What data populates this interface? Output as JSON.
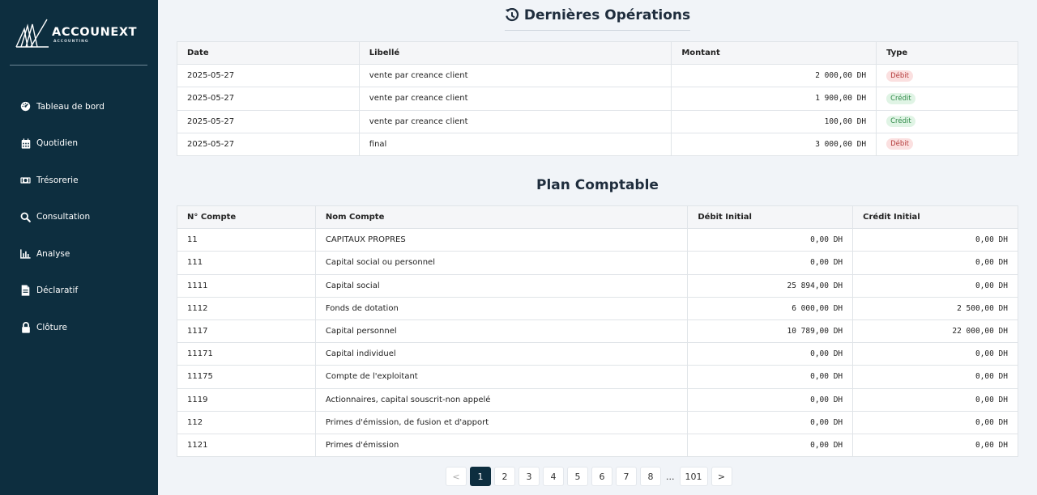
{
  "brand": {
    "name": "ACCOUNEXT",
    "subtitle": "ACCOUNTING"
  },
  "sidebar": {
    "items": [
      {
        "label": "Tableau de bord",
        "icon": "gauge-icon"
      },
      {
        "label": "Quotidien",
        "icon": "calendar-icon"
      },
      {
        "label": "Trésorerie",
        "icon": "money-bill-icon"
      },
      {
        "label": "Consultation",
        "icon": "search-icon"
      },
      {
        "label": "Analyse",
        "icon": "bar-chart-icon"
      },
      {
        "label": "Déclaratif",
        "icon": "file-icon"
      },
      {
        "label": "Clôture",
        "icon": "lock-icon"
      }
    ]
  },
  "operations": {
    "title": "Dernières Opérations",
    "headers": [
      "Date",
      "Libellé",
      "Montant",
      "Type"
    ],
    "rows": [
      {
        "date": "2025-05-27",
        "libelle": "vente par creance client",
        "montant": "2 000,00 DH",
        "type": "Débit"
      },
      {
        "date": "2025-05-27",
        "libelle": "vente par creance client",
        "montant": "1 900,00 DH",
        "type": "Crédit"
      },
      {
        "date": "2025-05-27",
        "libelle": "vente par creance client",
        "montant": "100,00 DH",
        "type": "Crédit"
      },
      {
        "date": "2025-05-27",
        "libelle": "final",
        "montant": "3 000,00 DH",
        "type": "Débit"
      }
    ]
  },
  "plan": {
    "title": "Plan Comptable",
    "headers": [
      "N° Compte",
      "Nom Compte",
      "Débit Initial",
      "Crédit Initial"
    ],
    "rows": [
      {
        "num": "11",
        "nom": "CAPITAUX PROPRES",
        "debit": "0,00 DH",
        "credit": "0,00 DH"
      },
      {
        "num": "111",
        "nom": "Capital social ou personnel",
        "debit": "0,00 DH",
        "credit": "0,00 DH"
      },
      {
        "num": "1111",
        "nom": "Capital social",
        "debit": "25 894,00 DH",
        "credit": "0,00 DH"
      },
      {
        "num": "1112",
        "nom": "Fonds de dotation",
        "debit": "6 000,00 DH",
        "credit": "2 500,00 DH"
      },
      {
        "num": "1117",
        "nom": "Capital personnel",
        "debit": "10 789,00 DH",
        "credit": "22 000,00 DH"
      },
      {
        "num": "11171",
        "nom": "Capital individuel",
        "debit": "0,00 DH",
        "credit": "0,00 DH"
      },
      {
        "num": "11175",
        "nom": "Compte de l'exploitant",
        "debit": "0,00 DH",
        "credit": "0,00 DH"
      },
      {
        "num": "1119",
        "nom": "Actionnaires, capital souscrit-non appelé",
        "debit": "0,00 DH",
        "credit": "0,00 DH"
      },
      {
        "num": "112",
        "nom": "Primes d'émission, de fusion et d'apport",
        "debit": "0,00 DH",
        "credit": "0,00 DH"
      },
      {
        "num": "1121",
        "nom": "Primes d'émission",
        "debit": "0,00 DH",
        "credit": "0,00 DH"
      }
    ]
  },
  "pagination": {
    "prev": "<",
    "next": ">",
    "pages": [
      "1",
      "2",
      "3",
      "4",
      "5",
      "6",
      "7",
      "8",
      "...",
      "101"
    ],
    "current": "1"
  },
  "colors": {
    "sidebar": "#0d2e3f",
    "debit_badge": "#fbe0e0",
    "credit_badge": "#e0f4e5"
  }
}
